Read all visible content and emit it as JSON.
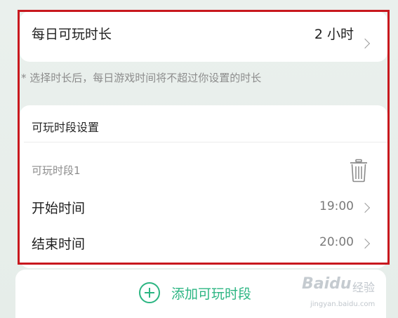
{
  "daily_limit": {
    "label": "每日可玩时长",
    "value": "2 小时"
  },
  "hint": "* 选择时长后，每日游戏时间将不超过你设置的时长",
  "period_settings": {
    "title": "可玩时段设置",
    "slot_name": "可玩时段1",
    "start_label": "开始时间",
    "start_value": "19:00",
    "end_label": "结束时间",
    "end_value": "20:00"
  },
  "add_period_label": "添加可玩时段",
  "watermark": {
    "logo": "Baidu",
    "name": "经验",
    "url": "jingyan.baidu.com"
  },
  "colors": {
    "accent": "#2bb582",
    "highlight_border": "#c8181e"
  },
  "icons": [
    "chevron-right-icon",
    "trash-icon",
    "plus-circle-icon"
  ]
}
